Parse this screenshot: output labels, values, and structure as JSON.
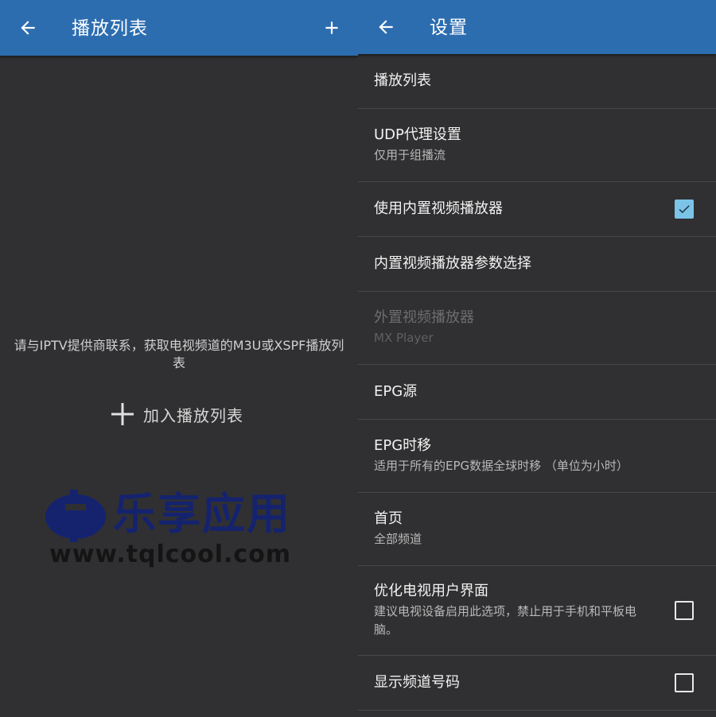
{
  "left": {
    "appbar": {
      "title": "播放列表",
      "back_icon": "arrow-left-icon",
      "add_icon": "plus-icon"
    },
    "empty_message": "请与IPTV提供商联系，获取电视频道的M3U或XSPF播放列表",
    "add_playlist_label": "加入播放列表",
    "watermark": {
      "name": "乐享应用",
      "url": "www.tqlcool.com"
    }
  },
  "right": {
    "appbar": {
      "title": "设置",
      "back_icon": "arrow-left-icon"
    },
    "items": [
      {
        "title": "播放列表",
        "subtitle": ""
      },
      {
        "title": "UDP代理设置",
        "subtitle": "仅用于组播流"
      },
      {
        "title": "使用内置视频播放器",
        "subtitle": "",
        "checkbox": true,
        "checked": true
      },
      {
        "title": "内置视频播放器参数选择",
        "subtitle": ""
      },
      {
        "title": "外置视频播放器",
        "subtitle": "MX Player",
        "disabled": true
      },
      {
        "title": "EPG源",
        "subtitle": ""
      },
      {
        "title": "EPG时移",
        "subtitle": "适用于所有的EPG数据全球时移 （单位为小时）"
      },
      {
        "title": "首页",
        "subtitle": "全部频道"
      },
      {
        "title": "优化电视用户界面",
        "subtitle": "建议电视设备启用此选项，禁止用于手机和平板电脑。",
        "checkbox": true,
        "checked": false
      },
      {
        "title": "显示频道号码",
        "subtitle": "",
        "checkbox": true,
        "checked": false
      }
    ]
  },
  "colors": {
    "appbar": "#2c6db0",
    "background": "#303032",
    "check_accent": "#7bc4e8"
  }
}
